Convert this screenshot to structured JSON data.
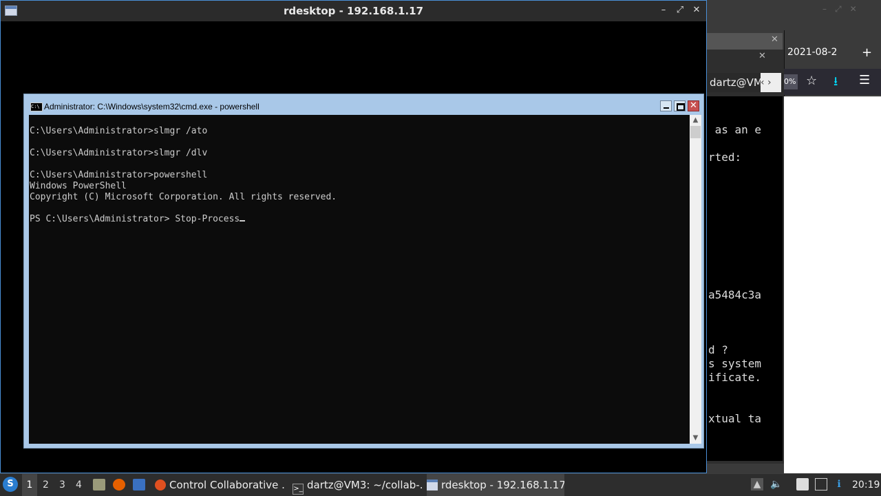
{
  "rdesktop": {
    "title": "rdesktop - 192.168.1.17",
    "controls": {
      "minimize": "–",
      "maximize": "⤢",
      "close": "✕"
    }
  },
  "cmd": {
    "title": "Administrator: C:\\Windows\\system32\\cmd.exe - powershell",
    "close_label": "✕",
    "icon_label": "C:\\",
    "lines": [
      "C:\\Users\\Administrator>slmgr /ato",
      "",
      "C:\\Users\\Administrator>slmgr /dlv",
      "",
      "C:\\Users\\Administrator>powershell",
      "Windows PowerShell",
      "Copyright (C) Microsoft Corporation. All rights reserved.",
      "",
      "PS C:\\Users\\Administrator> Stop-Process"
    ],
    "scroll_up": "▲",
    "scroll_down": "▼"
  },
  "background_terminal": {
    "path": "dartz@VM3",
    "nav": "‹ ›",
    "close": "✕",
    "lines": [
      " as an e",
      "",
      "rted:",
      "a5484c3a",
      "d ?",
      "s system",
      "ificate.",
      "xtual ta"
    ]
  },
  "background_browser": {
    "tab_label": "2021-08-2",
    "new_tab": "+",
    "zoom": "0%",
    "star": "☆",
    "download": "⭳",
    "menu": "☰"
  },
  "taskbar": {
    "start_label": "S",
    "workspaces": [
      "1",
      "2",
      "3",
      "4"
    ],
    "tasks": {
      "browser": "Control Collaborative ...",
      "terminal": "dartz@VM3: ~/collab-...",
      "rdesktop": "rdesktop - 192.168.1.17"
    },
    "terminal_icon_glyph": ">_",
    "tray": {
      "arrow": "▲",
      "volume": "🔈",
      "update": "ℹ"
    },
    "clock": "20:19"
  },
  "colors": {
    "console_bg": "#0c0c0c",
    "console_text": "#cccccc",
    "cmd_titlebar": "#a9c8e8",
    "taskbar": "#2d2d2d",
    "close_red": "#c75050"
  }
}
